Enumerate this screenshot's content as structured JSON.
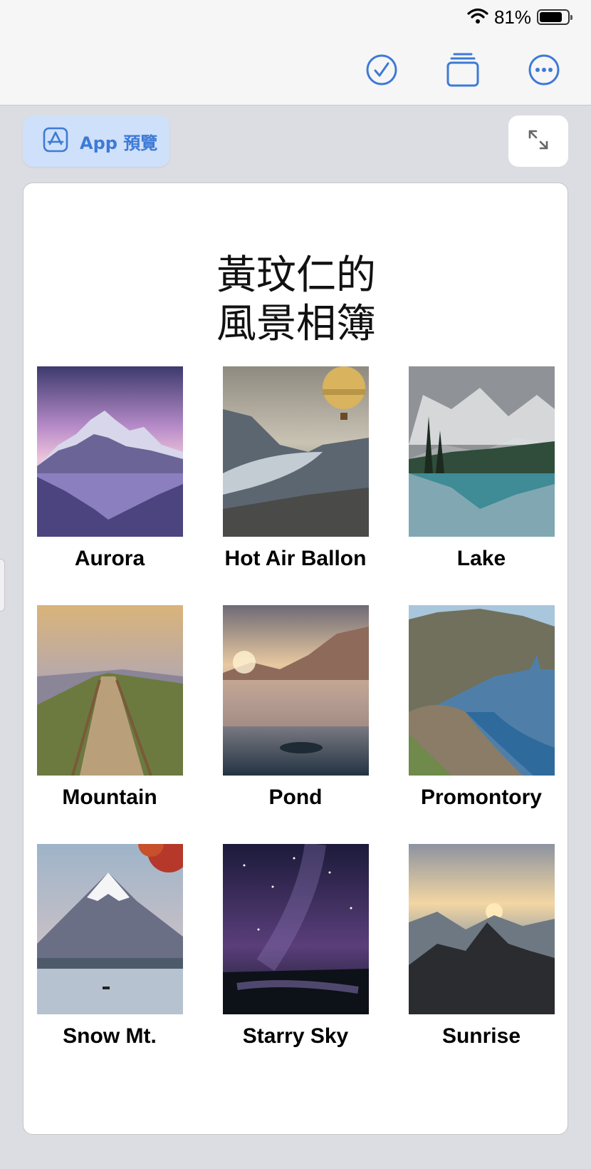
{
  "status": {
    "battery_percent": "81%",
    "battery_level": 0.81
  },
  "toolbar": {
    "icons": [
      "checkmark-circle-icon",
      "stack-icon",
      "ellipsis-circle-icon"
    ],
    "accent": "#3d7ad6"
  },
  "preview_button": {
    "label": "App 預覽",
    "icon": "app-store-icon"
  },
  "expand_button": {
    "icon": "expand-arrows-icon"
  },
  "album": {
    "title_line1": "黃玟仁的",
    "title_line2": "風景相簿",
    "photos": [
      {
        "label": "Aurora"
      },
      {
        "label": "Hot Air Ballon"
      },
      {
        "label": "Lake"
      },
      {
        "label": "Mountain"
      },
      {
        "label": "Pond"
      },
      {
        "label": "Promontory"
      },
      {
        "label": "Snow Mt."
      },
      {
        "label": "Starry Sky"
      },
      {
        "label": "Sunrise"
      }
    ]
  }
}
